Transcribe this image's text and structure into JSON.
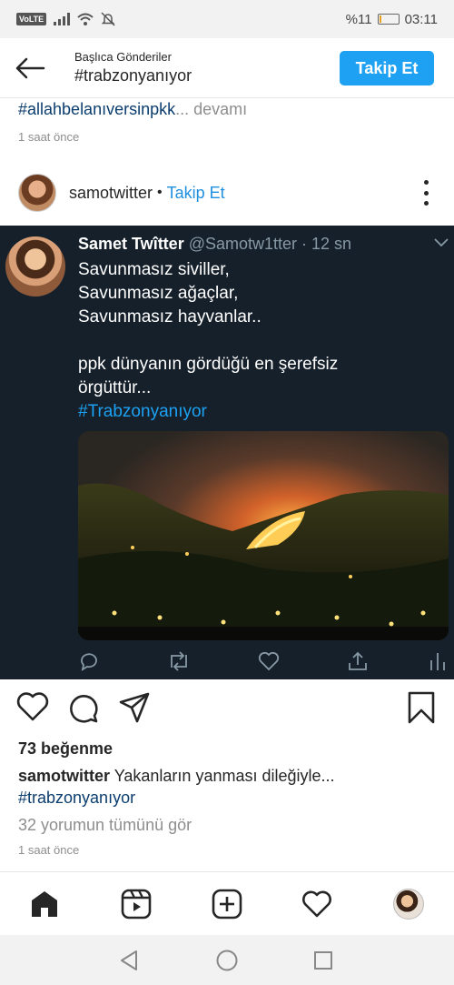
{
  "status_bar": {
    "network_badge": "VoLTE",
    "battery_text": "%11",
    "battery_level": 0.11,
    "time": "03:11"
  },
  "header": {
    "subtitle": "Başlıca Gönderiler",
    "title": "#trabzonyanıyor",
    "follow_label": "Takip Et",
    "accent": "#1ea1f2"
  },
  "previous_post": {
    "caption_hashtag": "#allahbelanıversinpkk",
    "caption_more": "... devamı",
    "time": "1 saat önce"
  },
  "post": {
    "username": "samotwitter",
    "separator": "•",
    "follow_label": "Takip Et",
    "tweet": {
      "name": "Samet Twîtter",
      "handle": "@Samotw1tter · 12 sn",
      "lines": [
        "Savunmasız siviller,",
        "Savunmasız ağaçlar,",
        "Savunmasız hayvanlar..",
        "",
        "ppk dünyanın gördüğü en şerefsiz",
        "örgüttür..."
      ],
      "hashtag": "#Trabzonyanıyor",
      "background": "#15202b"
    },
    "likes": "73 beğenme",
    "caption_user": "samotwitter",
    "caption_text": "Yakanların yanması dileğiyle...",
    "caption_hashtag": "#trabzonyanıyor",
    "comments_link": "32 yorumun tümünü gör",
    "time": "1 saat önce"
  },
  "icons": {
    "status": [
      "volte-icon",
      "signal-icon",
      "wifi-icon",
      "mute-icon",
      "battery-icon"
    ],
    "post_actions": [
      "heart-icon",
      "comment-icon",
      "share-icon",
      "bookmark-icon"
    ],
    "tweet_actions": [
      "reply-icon",
      "retweet-icon",
      "like-icon",
      "share-icon",
      "analytics-icon"
    ],
    "bottom_nav": [
      "home-icon",
      "reels-icon",
      "add-post-icon",
      "activity-heart-icon",
      "profile-avatar"
    ],
    "system_nav": [
      "back-triangle-icon",
      "home-circle-icon",
      "recents-square-icon"
    ]
  }
}
